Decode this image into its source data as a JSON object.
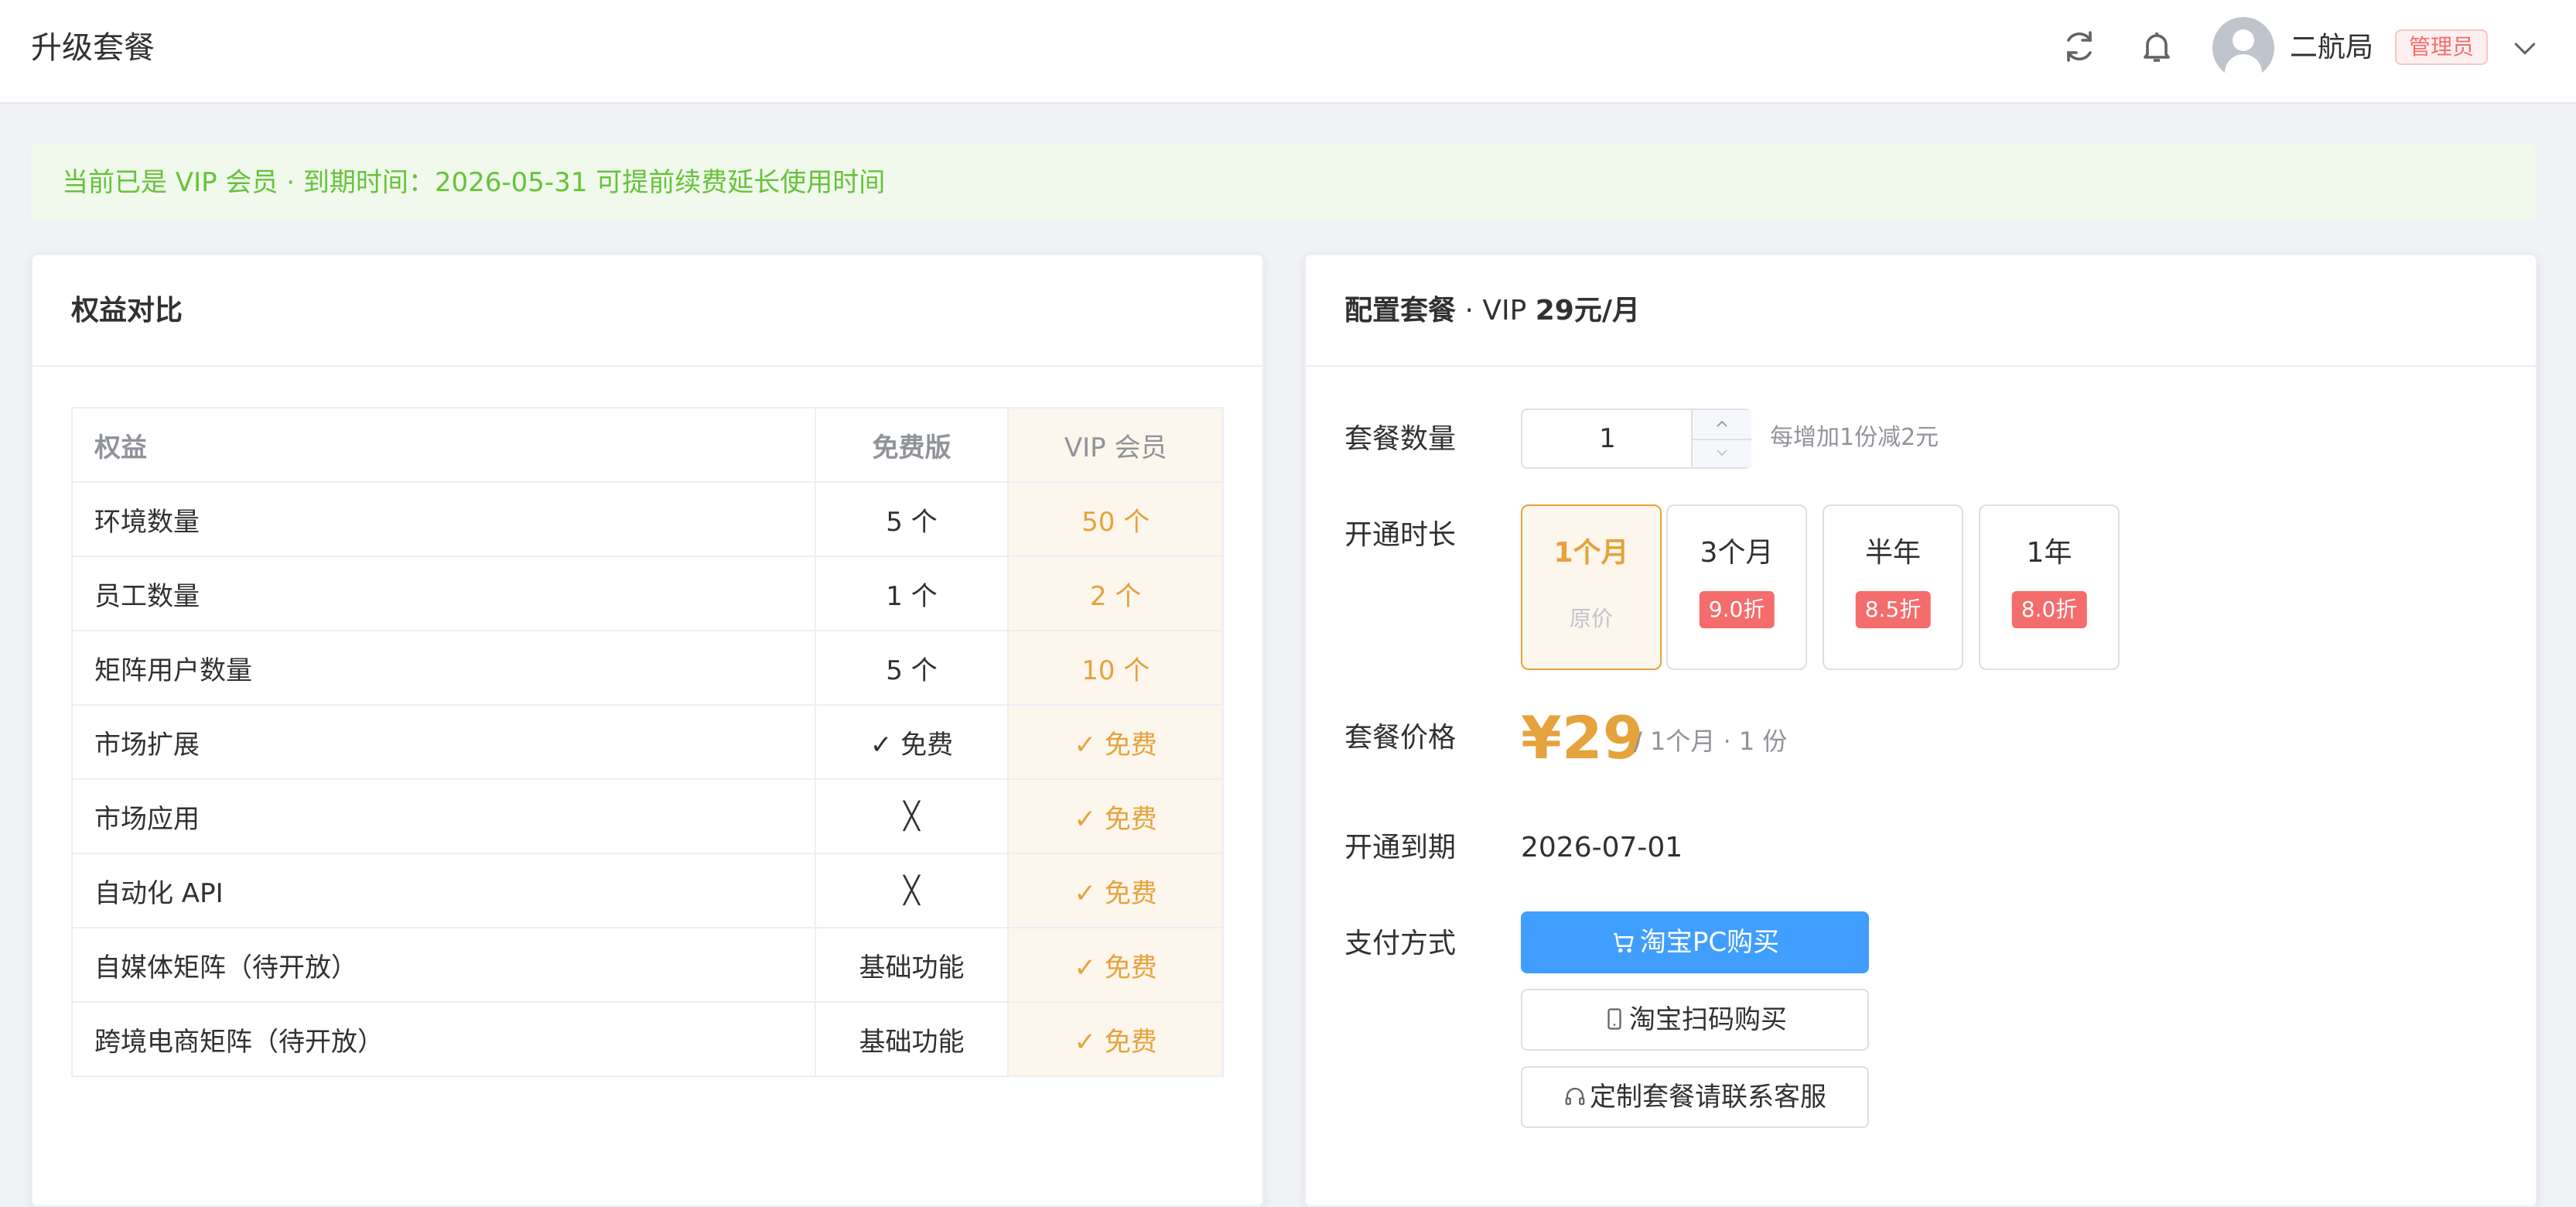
{
  "header": {
    "title": "升级套餐",
    "icons": [
      "refresh-icon",
      "bell-icon",
      "user-avatar-icon",
      "chevron-down-icon"
    ],
    "user_name": "二航局",
    "role": "管理员"
  },
  "alert": {
    "text": "当前已是 VIP 会员 · 到期时间：2026-05-31  可提前续费延长使用时间"
  },
  "benefits": {
    "title": "权益对比",
    "columns": [
      "权益",
      "免费版",
      "VIP 会员"
    ],
    "rows": [
      {
        "name": "环境数量",
        "free": "5 个",
        "vip": "50 个"
      },
      {
        "name": "员工数量",
        "free": "1 个",
        "vip": "2 个"
      },
      {
        "name": "矩阵用户数量",
        "free": "5 个",
        "vip": "10 个"
      },
      {
        "name": "市场扩展",
        "free": "✓ 免费",
        "vip": "✓ 免费"
      },
      {
        "name": "市场应用",
        "free": "╳",
        "vip": "✓ 免费"
      },
      {
        "name": "自动化 API",
        "free": "╳",
        "vip": "✓ 免费"
      },
      {
        "name": "自媒体矩阵（待开放）",
        "free": "基础功能",
        "vip": "✓ 免费"
      },
      {
        "name": "跨境电商矩阵（待开放）",
        "free": "基础功能",
        "vip": "✓ 免费"
      }
    ]
  },
  "config": {
    "title_bold": "配置套餐",
    "title_sep": " · VIP ",
    "title_price": "29元/月",
    "qty_label": "套餐数量",
    "qty_value": "1",
    "qty_hint": "每增加1份减2元",
    "duration_label": "开通时长",
    "durations": [
      {
        "label": "1个月",
        "sub": "原价"
      },
      {
        "label": "3个月",
        "discount": "9.0折"
      },
      {
        "label": "半年",
        "discount": "8.5折"
      },
      {
        "label": "1年",
        "discount": "8.0折"
      }
    ],
    "selected_duration": "1个月",
    "price_label": "套餐价格",
    "price": "¥29",
    "price_note": "/ 1个月 · 1 份",
    "expire_label": "开通到期",
    "expire_date": "2026-07-01",
    "pay_label": "支付方式",
    "pay_buttons": [
      "淘宝PC购买",
      "淘宝扫码购买",
      "定制套餐请联系客服"
    ],
    "colors": {
      "primary": "#409eff",
      "warning": "#e6a23c",
      "danger": "#f56c6c",
      "success": "#67c23a"
    }
  }
}
